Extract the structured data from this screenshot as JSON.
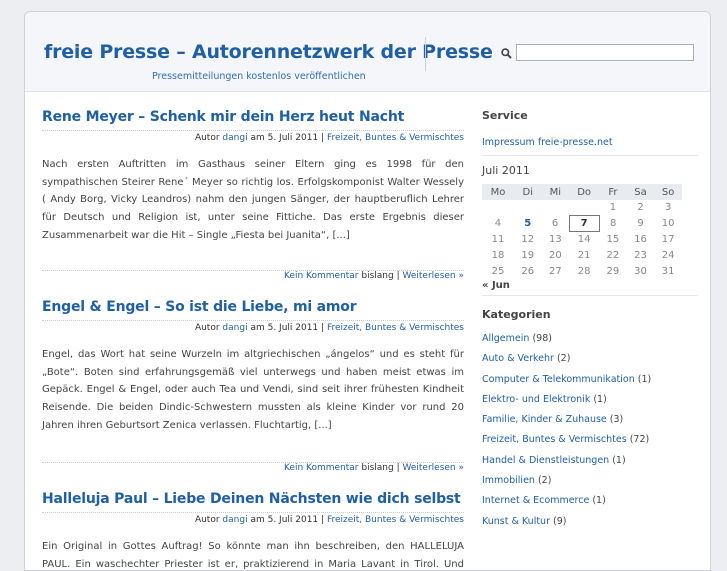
{
  "header": {
    "site_title": "freie Presse – Autorennetzwerk der Presse",
    "tagline": "Pressemitteilungen kostenlos veröffentlichen",
    "search_placeholder": ""
  },
  "posts": [
    {
      "title": "Rene Meyer – Schenk mir dein Herz heut Nacht",
      "meta_prefix": "Autor",
      "author": "dangi",
      "meta_date": "am 5. Juli 2011 |",
      "category": "Freizeit, Buntes & Vermischtes",
      "excerpt": "Nach ersten Auftritten im Gasthaus seiner Eltern ging es 1998 für den sympathischen Steirer Rene´ Meyer so richtig los. Erfolgskomponist Walter Wessely ( Andy Borg, Vicky Leandros) nahm den jungen Sänger, der hauptberuflich Lehrer für Deutsch und Religion ist, unter seine Fittiche. Das erste Ergebnis dieser Zusammenarbeit war die Hit – Single „Fiesta bei Juanita“, [...]",
      "comment_link": "Kein Kommentar",
      "comment_suffix": "bislang |",
      "more_link": "Weiterlesen »"
    },
    {
      "title": "Engel & Engel – So ist die Liebe, mi amor",
      "meta_prefix": "Autor",
      "author": "dangi",
      "meta_date": "am 5. Juli 2011 |",
      "category": "Freizeit, Buntes & Vermischtes",
      "excerpt": "Engel, das Wort hat seine Wurzeln im altgriechischen „ángelos“ und es steht für „Bote“. Boten sind erfahrungsgemäß viel unterwegs und haben meist etwas im Gepäck. Engel & Engel, oder auch Tea und Vendi, sind seit ihrer frühesten Kindheit Reisende. Die beiden Dindic-Schwestern mussten als kleine Kinder vor rund 20 Jahren ihren Geburtsort Zenica verlassen. Fluchtartig, [...]",
      "comment_link": "Kein Kommentar",
      "comment_suffix": "bislang |",
      "more_link": "Weiterlesen »"
    },
    {
      "title": "Halleluja Paul – Liebe Deinen Nächsten wie dich selbst",
      "meta_prefix": "Autor",
      "author": "dangi",
      "meta_date": "am 5. Juli 2011 |",
      "category": "Freizeit, Buntes & Vermischtes",
      "excerpt": "Ein Original in Gottes Auftrag! So könnte man ihn beschreiben, den HALLELUJA PAUL. Ein waschechter Priester ist er, praktizierend in Maria Lavant in Tirol. Und jetzt"
    }
  ],
  "sidebar": {
    "service_heading": "Service",
    "service_link": "Impressum freie-presse.net",
    "calendar_title": "Juli 2011",
    "weekdays": [
      "Mo",
      "Di",
      "Mi",
      "Do",
      "Fr",
      "Sa",
      "So"
    ],
    "weeks": [
      [
        "",
        "",
        "",
        "",
        "1",
        "2",
        "3"
      ],
      [
        "4",
        "5",
        "6",
        "7",
        "8",
        "9",
        "10"
      ],
      [
        "11",
        "12",
        "13",
        "14",
        "15",
        "16",
        "17"
      ],
      [
        "18",
        "19",
        "20",
        "21",
        "22",
        "23",
        "24"
      ],
      [
        "25",
        "26",
        "27",
        "28",
        "29",
        "30",
        "31"
      ]
    ],
    "linked_day": "5",
    "today": "7",
    "prev_month": "« Jun",
    "categories_heading": "Kategorien",
    "categories": [
      {
        "name": "Allgemein",
        "count": "(98)"
      },
      {
        "name": "Auto & Verkehr",
        "count": "(2)"
      },
      {
        "name": "Computer & Telekommunikation",
        "count": "(1)"
      },
      {
        "name": "Elektro- und Elektronik",
        "count": "(1)"
      },
      {
        "name": "Familie, Kinder & Zuhause",
        "count": "(3)"
      },
      {
        "name": "Freizeit, Buntes & Vermischtes",
        "count": "(72)"
      },
      {
        "name": "Handel & Dienstleistungen",
        "count": "(1)"
      },
      {
        "name": "Immobilien",
        "count": "(2)"
      },
      {
        "name": "Internet & Ecommerce",
        "count": "(1)"
      },
      {
        "name": "Kunst & Kultur",
        "count": "(9)"
      }
    ]
  }
}
